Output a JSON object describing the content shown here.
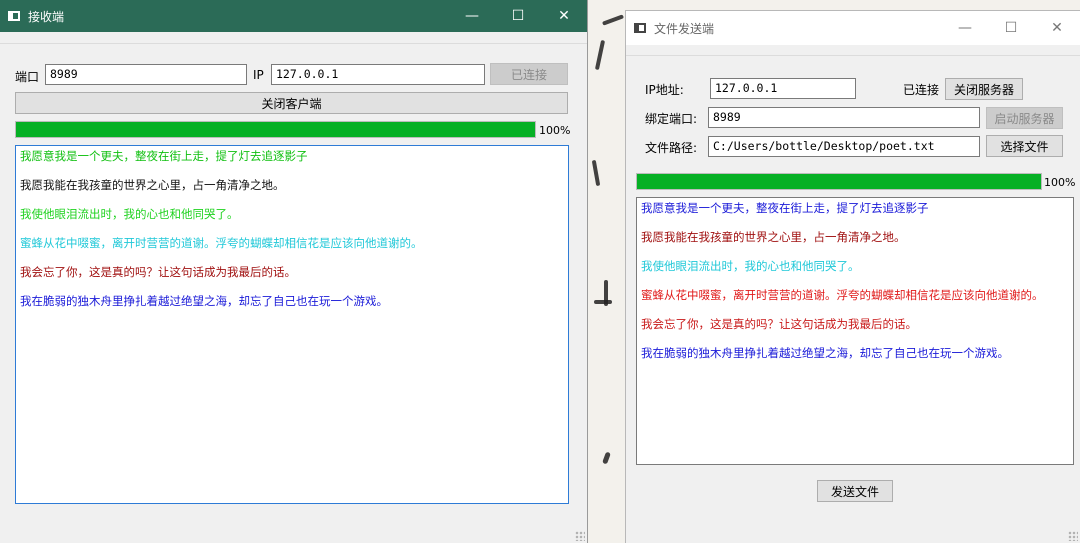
{
  "receiver": {
    "title": "接收端",
    "port_label": "端口",
    "port_value": "8989",
    "ip_label": "IP",
    "ip_value": "127.0.0.1",
    "connect_button": "已连接",
    "close_client_button": "关闭客户端",
    "progress_value": 1.0,
    "progress_text": "100%",
    "messages": [
      {
        "text": "我愿意我是一个更夫，整夜在街上走，提了灯去追逐影子",
        "color": "#11c011"
      },
      {
        "text": "我愿我能在我孩童的世界之心里，占一角清净之地。",
        "color": "#111111"
      },
      {
        "text": "我使他眼泪流出时，我的心也和他同哭了。",
        "color": "#1fd21f"
      },
      {
        "text": "蜜蜂从花中啜蜜，离开时营营的道谢。浮夸的蝴蝶却相信花是应该向他道谢的。",
        "color": "#20c8d8"
      },
      {
        "text": "我会忘了你，这是真的吗？让这句话成为我最后的话。",
        "color": "#a01010"
      },
      {
        "text": "我在脆弱的独木舟里挣扎着越过绝望之海，却忘了自己也在玩一个游戏。",
        "color": "#1a1ad8"
      }
    ]
  },
  "sender": {
    "title": "文件发送端",
    "ip_label": "IP地址:",
    "ip_value": "127.0.0.1",
    "connected_status": "已连接",
    "close_server_button": "关闭服务器",
    "bind_port_label": "绑定端口:",
    "bind_port_value": "8989",
    "start_server_button": "启动服务器",
    "file_path_label": "文件路径:",
    "file_path_value": "C:/Users/bottle/Desktop/poet.txt",
    "choose_file_button": "选择文件",
    "progress_value": 1.0,
    "progress_text": "100%",
    "send_file_button": "发送文件",
    "messages": [
      {
        "text": "我愿意我是一个更夫，整夜在街上走，提了灯去追逐影子",
        "color": "#1a1ad8"
      },
      {
        "text": "我愿我能在我孩童的世界之心里，占一角清净之地。",
        "color": "#a01010"
      },
      {
        "text": "我使他眼泪流出时，我的心也和他同哭了。",
        "color": "#20c8d8"
      },
      {
        "text": "蜜蜂从花中啜蜜，离开时营营的道谢。浮夸的蝴蝶却相信花是应该向他道谢的。",
        "color": "#e01818"
      },
      {
        "text": "我会忘了你，这是真的吗？让这句话成为我最后的话。",
        "color": "#c81818"
      },
      {
        "text": "我在脆弱的独木舟里挣扎着越过绝望之海，却忘了自己也在玩一个游戏。",
        "color": "#1a1ad8"
      }
    ]
  },
  "window_controls": {
    "minimize_icon": "minimize-icon",
    "maximize_icon": "maximize-icon",
    "close_icon": "close-icon"
  }
}
